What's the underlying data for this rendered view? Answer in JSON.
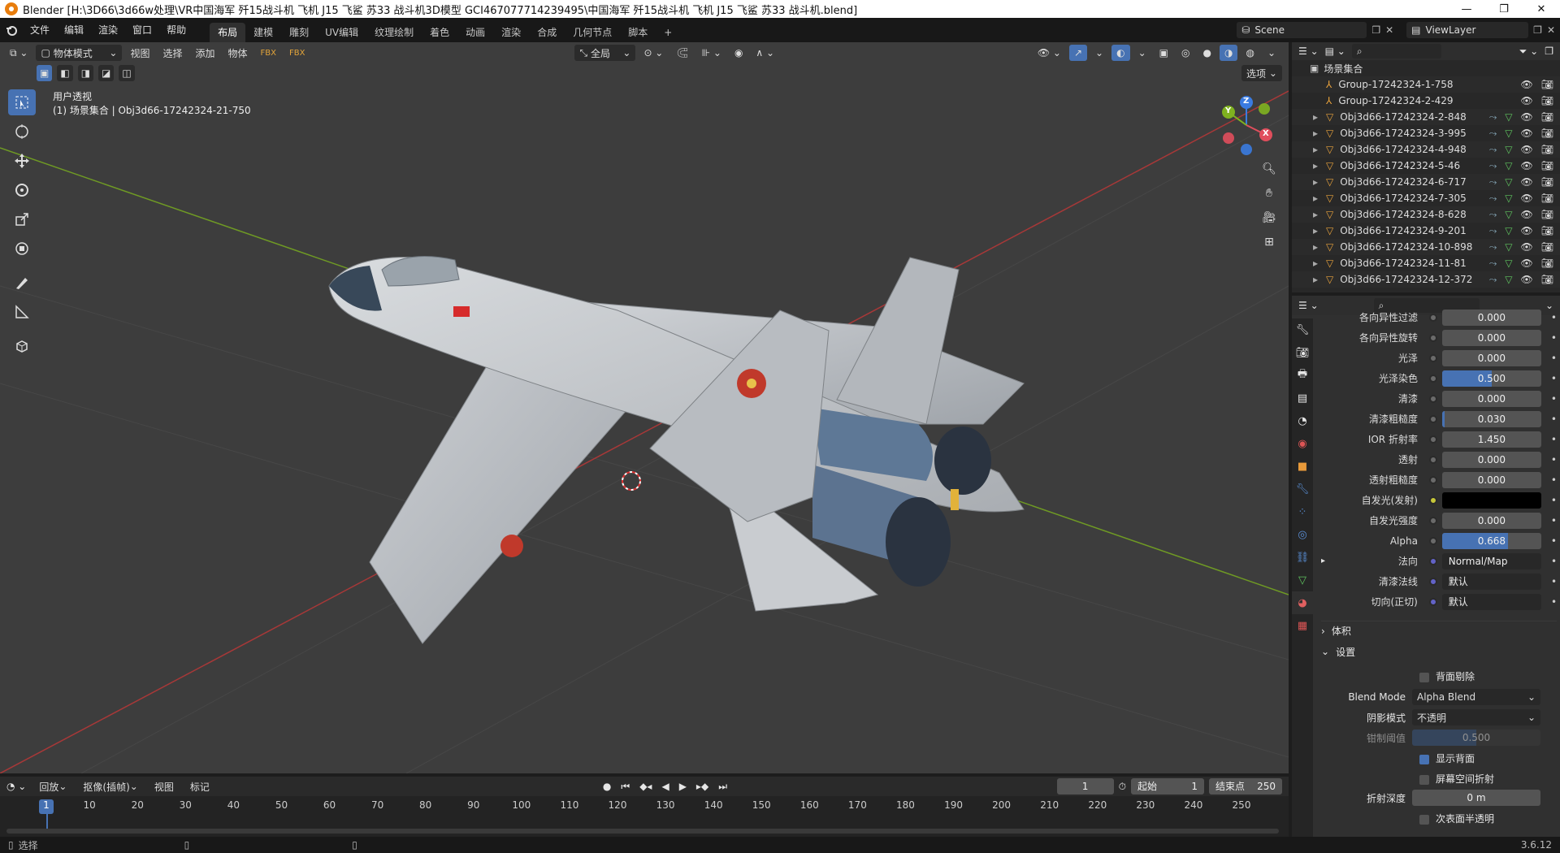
{
  "titlebar": {
    "title": "Blender [H:\\3D66\\3d66w处理\\VR中国海军 歼15战斗机 飞机 J15 飞鲨  苏33 战斗机3D模型 GCI467077714239495\\中国海军 歼15战斗机 飞机 J15 飞鲨  苏33 战斗机.blend]",
    "min": "—",
    "max": "❐",
    "close": "✕"
  },
  "menu": [
    "文件",
    "编辑",
    "渲染",
    "窗口",
    "帮助"
  ],
  "workspaces": [
    "布局",
    "建模",
    "雕刻",
    "UV编辑",
    "纹理绘制",
    "着色",
    "动画",
    "渲染",
    "合成",
    "几何节点",
    "脚本",
    "+"
  ],
  "scene": {
    "name": "Scene",
    "viewlayer": "ViewLayer"
  },
  "viewport_header": {
    "mode": "物体模式",
    "menus": [
      "视图",
      "选择",
      "添加",
      "物体"
    ],
    "transform": "全局",
    "options": "选项"
  },
  "viewport": {
    "view_name": "用户透视",
    "collection_info": "(1) 场景集合 | Obj3d66-17242324-21-750",
    "gizmo": {
      "x": "X",
      "y": "Y",
      "z": "Z"
    },
    "colors": {
      "x_axis": "#a83838",
      "y_axis": "#6f9a24",
      "gizmo_x": "#e04e5c",
      "gizmo_y": "#7fb21f",
      "gizmo_z": "#3a7be0"
    }
  },
  "outliner": {
    "root": "场景集合",
    "items": [
      {
        "name": "Group-17242324-1-758",
        "type": "empty"
      },
      {
        "name": "Group-17242324-2-429",
        "type": "empty"
      },
      {
        "name": "Obj3d66-17242324-2-848",
        "type": "mesh"
      },
      {
        "name": "Obj3d66-17242324-3-995",
        "type": "mesh"
      },
      {
        "name": "Obj3d66-17242324-4-948",
        "type": "mesh"
      },
      {
        "name": "Obj3d66-17242324-5-46",
        "type": "mesh"
      },
      {
        "name": "Obj3d66-17242324-6-717",
        "type": "mesh"
      },
      {
        "name": "Obj3d66-17242324-7-305",
        "type": "mesh"
      },
      {
        "name": "Obj3d66-17242324-8-628",
        "type": "mesh"
      },
      {
        "name": "Obj3d66-17242324-9-201",
        "type": "mesh"
      },
      {
        "name": "Obj3d66-17242324-10-898",
        "type": "mesh"
      },
      {
        "name": "Obj3d66-17242324-11-81",
        "type": "mesh"
      },
      {
        "name": "Obj3d66-17242324-12-372",
        "type": "mesh"
      }
    ]
  },
  "properties": {
    "rows": [
      {
        "label": "各向异性过滤",
        "value": "0.000",
        "fill": 0
      },
      {
        "label": "各向异性旋转",
        "value": "0.000",
        "fill": 0
      },
      {
        "label": "光泽",
        "value": "0.000",
        "fill": 0
      },
      {
        "label": "光泽染色",
        "value": "0.500",
        "fill": 0.5
      },
      {
        "label": "清漆",
        "value": "0.000",
        "fill": 0
      },
      {
        "label": "清漆粗糙度",
        "value": "0.030",
        "fill": 0.03
      },
      {
        "label": "IOR 折射率",
        "value": "1.450",
        "fill": 0
      },
      {
        "label": "透射",
        "value": "0.000",
        "fill": 0
      },
      {
        "label": "透射粗糙度",
        "value": "0.000",
        "fill": 0
      },
      {
        "label": "自发光(发射)",
        "value": "",
        "fill": 0,
        "color": "#000000"
      },
      {
        "label": "自发光强度",
        "value": "0.000",
        "fill": 0
      },
      {
        "label": "Alpha",
        "value": "0.668",
        "fill": 0.668
      },
      {
        "label": "法向",
        "value": "Normal/Map",
        "fill": 0,
        "link": true
      },
      {
        "label": "清漆法线",
        "value": "默认",
        "fill": 0,
        "link": true
      },
      {
        "label": "切向(正切)",
        "value": "默认",
        "fill": 0,
        "link": true
      }
    ],
    "panel_volume": "体积",
    "panel_settings": "设置",
    "settings": {
      "backface_culling": "背面剔除",
      "blend_mode_label": "Blend Mode",
      "blend_mode": "Alpha Blend",
      "shadow_mode_label": "阴影模式",
      "shadow_mode": "不透明",
      "clip_label": "钳制阈值",
      "clip_value": "0.500",
      "show_backface": "显示背面",
      "screen_refraction": "屏幕空间折射",
      "refraction_depth_label": "折射深度",
      "refraction_depth": "0 m",
      "subsurface": "次表面半透明"
    }
  },
  "timeline": {
    "menus": [
      "回放",
      "抠像(插帧)",
      "视图",
      "标记"
    ],
    "current_frame": "1",
    "start_label": "起始",
    "start": "1",
    "end_label": "结束点",
    "end": "250",
    "ticks": [
      "1",
      "10",
      "20",
      "30",
      "40",
      "50",
      "60",
      "70",
      "80",
      "90",
      "100",
      "110",
      "120",
      "130",
      "140",
      "150",
      "160",
      "170",
      "180",
      "190",
      "200",
      "210",
      "220",
      "230",
      "240",
      "250"
    ]
  },
  "status": {
    "select": "选择",
    "version": "3.6.12"
  }
}
